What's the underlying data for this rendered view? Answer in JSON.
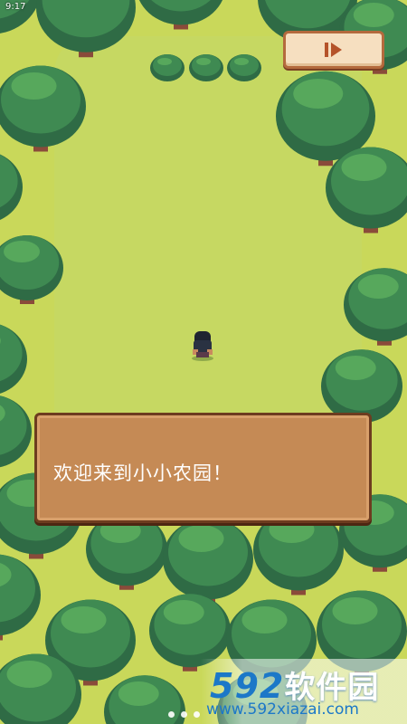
{
  "status_bar": {
    "time": "9:17"
  },
  "dialog": {
    "text": "欢迎来到小小农园！"
  },
  "pager": {
    "count": 3
  },
  "watermark": {
    "brand_number": "592",
    "brand_name": "软件园",
    "url": "www.592xiazai.com"
  },
  "colors": {
    "grass": "#c9d85a",
    "tree_dark": "#2f6b45",
    "tree_mid": "#3f8a52",
    "tree_light": "#57a85c",
    "trunk": "#8a4b3a",
    "dialog_bg": "#c58a55",
    "skip_bg": "#f6dfc0",
    "skip_icon": "#b5532a"
  }
}
